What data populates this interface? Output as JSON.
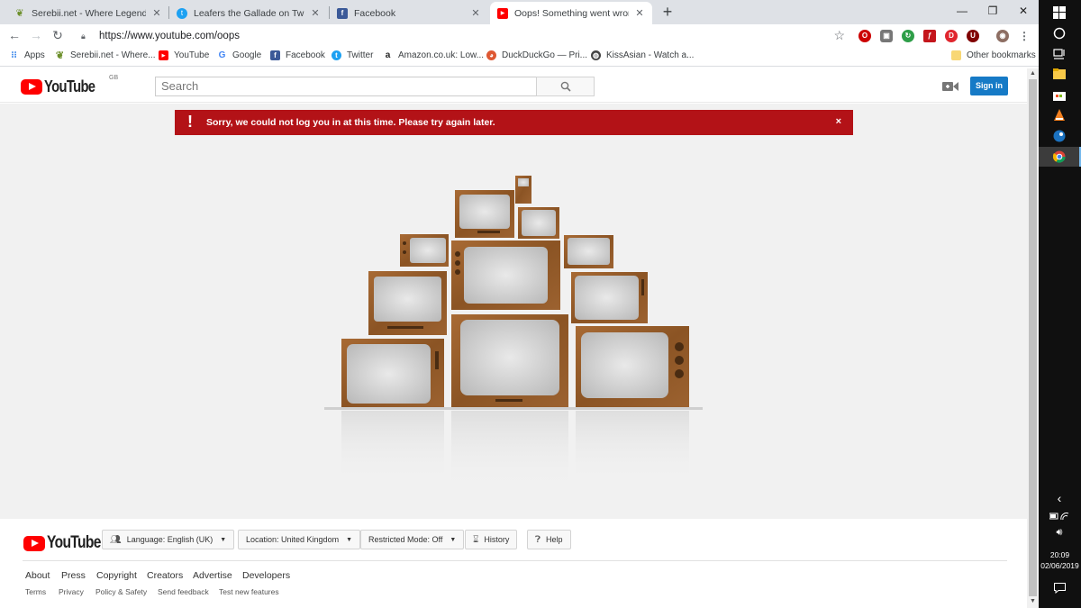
{
  "browser": {
    "tabs": [
      {
        "title": "Serebii.net - Where Legends Com",
        "icon": "serebii-icon",
        "active": false
      },
      {
        "title": "Leafers the Gallade on Twitter: \"F",
        "icon": "twitter-icon",
        "active": false
      },
      {
        "title": "Facebook",
        "icon": "facebook-icon",
        "active": false
      },
      {
        "title": "Oops! Something went wrong. -",
        "icon": "youtube-icon",
        "active": true
      }
    ],
    "url": "https://www.youtube.com/oops",
    "bookmarks": [
      {
        "label": "Apps",
        "icon": "apps-grid-icon"
      },
      {
        "label": "Serebii.net - Where...",
        "icon": "serebii-icon"
      },
      {
        "label": "YouTube",
        "icon": "youtube-icon"
      },
      {
        "label": "Google",
        "icon": "google-icon"
      },
      {
        "label": "Facebook",
        "icon": "facebook-icon"
      },
      {
        "label": "Twitter",
        "icon": "twitter-icon"
      },
      {
        "label": "Amazon.co.uk: Low...",
        "icon": "amazon-icon"
      },
      {
        "label": "DuckDuckGo — Pri...",
        "icon": "duckduckgo-icon"
      },
      {
        "label": "KissAsian - Watch a...",
        "icon": "kissasian-icon"
      }
    ],
    "other_bookmarks": "Other bookmarks"
  },
  "youtube": {
    "logo_text": "YouTube",
    "region": "GB",
    "search_placeholder": "Search",
    "signin_label": "Sign in",
    "alert_icon": "!",
    "alert_message": "Sorry, we could not log you in at this time. Please try again later.",
    "alert_close": "×",
    "footer": {
      "language_button": "Language: English (UK)",
      "location_button": "Location: United Kingdom",
      "restricted_button": "Restricted Mode: Off",
      "history_button": "History",
      "help_button": "Help",
      "links_primary": [
        "About",
        "Press",
        "Copyright",
        "Creators",
        "Advertise",
        "Developers"
      ],
      "links_secondary": [
        "Terms",
        "Privacy",
        "Policy & Safety",
        "Send feedback",
        "Test new features"
      ]
    },
    "colors": {
      "brand_red": "#ff0000",
      "alert_red": "#b31217",
      "signin_blue": "#167ac6",
      "tv_wood": "#8b5a2b"
    }
  },
  "taskbar": {
    "time": "20:09",
    "date": "02/06/2019"
  }
}
